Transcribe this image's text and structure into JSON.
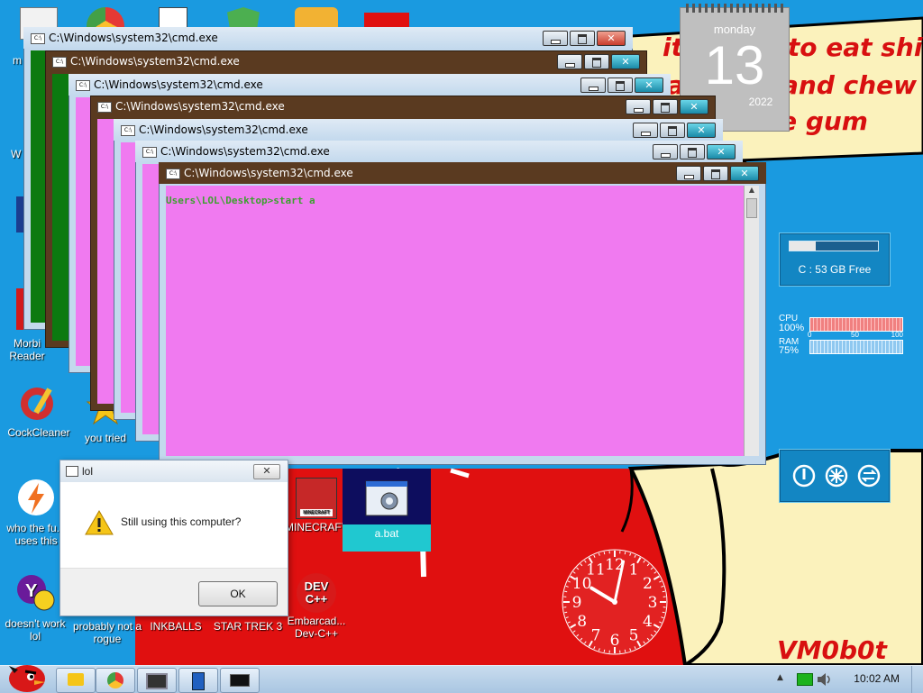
{
  "wallpaper": {
    "speech_line1": "it's time to eat shit",
    "speech_line2": "and die and chew",
    "speech_line3": "some gum",
    "signature": "VM0b0t"
  },
  "calendar": {
    "weekday": "monday",
    "day": "13",
    "year": "2022"
  },
  "desktop_icons": [
    {
      "label": "CockCleaner"
    },
    {
      "label": "you tried"
    },
    {
      "label": "who the fu... uses this"
    },
    {
      "label": "doesn't work lol"
    },
    {
      "label": "probably not a rogue"
    },
    {
      "label": "INKBALLS"
    },
    {
      "label": "STAR TREK 3"
    },
    {
      "label": "Embarcad... Dev-C++"
    },
    {
      "label": "MINECRAFT"
    },
    {
      "label": "a.bat"
    },
    {
      "label": "Morbi Reader"
    }
  ],
  "devcpp_icon_text": "DEV C++",
  "minecraft_icon_text": "MINECRAFT",
  "cmd_windows": [
    {
      "title": "C:\\Windows\\system32\\cmd.exe"
    },
    {
      "title": "C:\\Windows\\system32\\cmd.exe"
    },
    {
      "title": "C:\\Windows\\system32\\cmd.exe"
    },
    {
      "title": "C:\\Windows\\system32\\cmd.exe"
    },
    {
      "title": "C:\\Windows\\system32\\cmd.exe"
    },
    {
      "title": "C:\\Windows\\system32\\cmd.exe"
    },
    {
      "title": "C:\\Windows\\system32\\cmd.exe"
    }
  ],
  "cmd_console_line": "Users\\LOL\\Desktop>start a",
  "disk_gadget": {
    "label": "C : 53 GB Free",
    "used_fraction": 0.3
  },
  "cpu_gadget": {
    "cpu_label": "CPU",
    "cpu_value": "100%",
    "ram_label": "RAM",
    "ram_value": "75%",
    "scale": [
      "0",
      "50",
      "100"
    ]
  },
  "analog_clock": {
    "hour": 10,
    "minute": 2,
    "numerals": [
      "12",
      "1",
      "2",
      "3",
      "4",
      "5",
      "6",
      "7",
      "8",
      "9",
      "10",
      "11"
    ]
  },
  "dialog": {
    "title": "lol",
    "message": "Still using this computer?",
    "ok_label": "OK",
    "close_label": "✕"
  },
  "taskbar": {
    "time": "10:02 AM"
  },
  "colors": {
    "desktop": "#1a9ae0",
    "cmd_pink": "#f07af0",
    "cmd_green": "#0c7a10",
    "cmd_frame_brown": "#5a3a20",
    "wall_red": "#e01010",
    "wall_yellow": "#fbf2bc"
  }
}
